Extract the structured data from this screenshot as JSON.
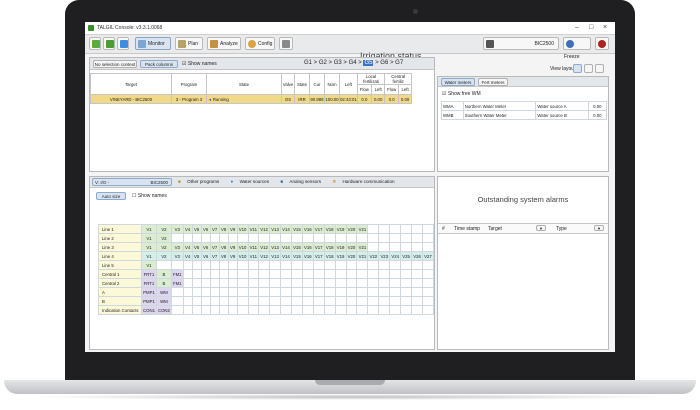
{
  "window": {
    "title": "TALGIL Console: v3.3.1.0068"
  },
  "toolbar": {
    "monitor": "Monitor",
    "plan": "Plan",
    "analyze": "Analyze",
    "config": "Config",
    "page_title": "Irrigation status",
    "controller": "BIC2500",
    "freeze": "Freeze"
  },
  "status_panel": {
    "btn_no_selection": "No selection context",
    "btn_pack_columns": "Pack columns",
    "show_names": "Show names",
    "breadcrumb": [
      "G1",
      "G2",
      "G3",
      "G4",
      "G5",
      "G6",
      "G7"
    ],
    "breadcrumb_active": "G5",
    "view_layout": "View layout",
    "headers": {
      "target": "Target",
      "program": "Program",
      "state": "State",
      "valve": "Valve",
      "state2": "State",
      "cur": "Cur",
      "nom": "Nom",
      "left": "Left",
      "local_fert": "Local fertilizati",
      "central_fert": "Central fertiliz",
      "flow": "Flow",
      "left2": "Left",
      "flow2": "Flow",
      "left3": "Left"
    },
    "row": {
      "target": "VINEYARD - BIC2500",
      "program": "3 - Program 3",
      "state": "Running",
      "valve": "OS",
      "state2": "IRR",
      "cur": "90.888",
      "nom": "100.00",
      "left": "02:43:01",
      "f1": "0.0",
      "l1": "0.00",
      "f2": "0.0",
      "l2": "0.00"
    }
  },
  "meters": {
    "tab_water": "Water meters",
    "tab_fert": "Fert meters",
    "show_free": "Show free WM",
    "rows": [
      {
        "id": "WMA",
        "name": "Northern Water Meter",
        "source": "Water source A",
        "value": "0.00"
      },
      {
        "id": "WMB",
        "name": "Southern Water Meter",
        "source": "Water source B",
        "value": "0.00"
      }
    ]
  },
  "io_panel": {
    "controller_label": "V: I/O -",
    "controller_name": "BIC2500",
    "tabs": [
      "Other programs",
      "Water sources",
      "Analog sensors",
      "Hardware communication"
    ],
    "auto_size": "Auto size",
    "show_names": "Show names",
    "rows": [
      {
        "label": "Line 1",
        "cells": [
          "V1",
          "V2",
          "V3",
          "V4",
          "V5",
          "V6",
          "V7",
          "V8",
          "V9",
          "V10",
          "V11",
          "V12",
          "V13",
          "V14",
          "V15",
          "V16",
          "V17",
          "V18",
          "V19",
          "V20",
          "V21"
        ]
      },
      {
        "label": "Line 2",
        "cells": [
          "V1",
          "V2"
        ]
      },
      {
        "label": "Line 3",
        "cells": [
          "V1",
          "V2",
          "V3",
          "V4",
          "V5",
          "V6",
          "V7",
          "V8",
          "V9",
          "V10",
          "V11",
          "V12",
          "V13",
          "V14",
          "V15",
          "V16",
          "V17",
          "V18",
          "V19",
          "V20",
          "V21"
        ]
      },
      {
        "label": "Line 4",
        "cells": [
          "V1",
          "V2",
          "V3",
          "V4",
          "V5",
          "V6",
          "V7",
          "V8",
          "V9",
          "V10",
          "V11",
          "V12",
          "V13",
          "V14",
          "V15",
          "V16",
          "V17",
          "V18",
          "V19",
          "V20",
          "V21",
          "V22",
          "V23",
          "V24",
          "V25",
          "V26",
          "V27"
        ]
      },
      {
        "label": "Line 5",
        "cells": [
          "V1"
        ]
      },
      {
        "label": "Central 1",
        "cells": [
          "FRT1",
          "B",
          "FM1"
        ]
      },
      {
        "label": "Central 2",
        "cells": [
          "FRT1",
          "B",
          "FM1"
        ]
      },
      {
        "label": "A",
        "cells": [
          "PMP1",
          "WM"
        ]
      },
      {
        "label": "B",
        "cells": [
          "PMP1",
          "WM"
        ]
      },
      {
        "label": "Indication Contacts",
        "cells": [
          "CON1",
          "CON2"
        ]
      }
    ]
  },
  "alarms": {
    "title": "Outstanding system alarms",
    "col_num": "#",
    "col_time": "Time stamp",
    "col_target": "Target",
    "col_type": "Type"
  }
}
